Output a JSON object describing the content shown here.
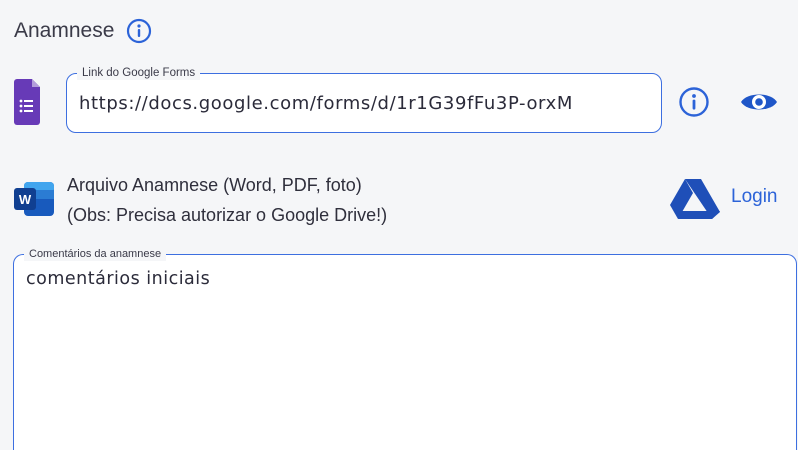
{
  "section": {
    "title": "Anamnese"
  },
  "google_forms": {
    "legend": "Link do Google Forms",
    "value": "https://docs.google.com/forms/d/1r1G39fFu3P-orxM"
  },
  "word_file": {
    "line1": "Arquivo Anamnese (Word, PDF, foto)",
    "line2": "(Obs: Precisa autorizar o Google Drive!)",
    "login_label": "Login"
  },
  "comments": {
    "legend": "Comentários da anamnese",
    "value": "comentários iniciais"
  },
  "colors": {
    "accent": "#2c63d8",
    "field_border": "#3d6fe0",
    "forms_purple": "#673ab7",
    "word_blue": "#185abd",
    "drive_blue": "#1f4fb8"
  },
  "icons": {
    "title_info": "info-icon",
    "forms": "google-forms-icon",
    "forms_info": "info-icon",
    "preview": "eye-icon",
    "word": "word-icon",
    "drive": "google-drive-icon"
  }
}
